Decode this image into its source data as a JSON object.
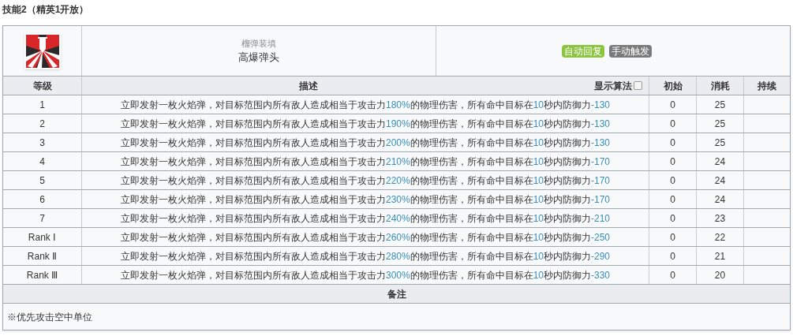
{
  "title": "技能2（精英1开放）",
  "skill": {
    "subtitle": "榴弹装填",
    "name": "高爆弹头",
    "tags": [
      {
        "text": "自动回复",
        "color": "#8cc43f"
      },
      {
        "text": "手动触发",
        "color": "#7a7a7a"
      }
    ]
  },
  "columns": {
    "level": "等级",
    "description": "描述",
    "formula_toggle": {
      "label": "显示算法",
      "checked": false
    },
    "initial": "初始",
    "cost": "消耗",
    "duration": "持续"
  },
  "rows": [
    {
      "level": "1",
      "parts": [
        {
          "kind": "plain",
          "text": "立即发射一枚火焰弹，对目标范围内所有敌人造成相当于攻击力"
        },
        {
          "kind": "value",
          "text": "180%"
        },
        {
          "kind": "plain",
          "text": "的物理伤害，所有命中目标在"
        },
        {
          "kind": "value",
          "text": "10"
        },
        {
          "kind": "plain",
          "text": "秒内防御力"
        },
        {
          "kind": "value",
          "text": "-130"
        }
      ],
      "initial": "0",
      "cost": "25"
    },
    {
      "level": "2",
      "parts": [
        {
          "kind": "plain",
          "text": "立即发射一枚火焰弹，对目标范围内所有敌人造成相当于攻击力"
        },
        {
          "kind": "value",
          "text": "190%"
        },
        {
          "kind": "plain",
          "text": "的物理伤害，所有命中目标在"
        },
        {
          "kind": "value",
          "text": "10"
        },
        {
          "kind": "plain",
          "text": "秒内防御力"
        },
        {
          "kind": "value",
          "text": "-130"
        }
      ],
      "initial": "0",
      "cost": "25"
    },
    {
      "level": "3",
      "parts": [
        {
          "kind": "plain",
          "text": "立即发射一枚火焰弹，对目标范围内所有敌人造成相当于攻击力"
        },
        {
          "kind": "value",
          "text": "200%"
        },
        {
          "kind": "plain",
          "text": "的物理伤害，所有命中目标在"
        },
        {
          "kind": "value",
          "text": "10"
        },
        {
          "kind": "plain",
          "text": "秒内防御力"
        },
        {
          "kind": "value",
          "text": "-130"
        }
      ],
      "initial": "0",
      "cost": "25"
    },
    {
      "level": "4",
      "parts": [
        {
          "kind": "plain",
          "text": "立即发射一枚火焰弹，对目标范围内所有敌人造成相当于攻击力"
        },
        {
          "kind": "value",
          "text": "210%"
        },
        {
          "kind": "plain",
          "text": "的物理伤害，所有命中目标在"
        },
        {
          "kind": "value",
          "text": "10"
        },
        {
          "kind": "plain",
          "text": "秒内防御力"
        },
        {
          "kind": "value",
          "text": "-170"
        }
      ],
      "initial": "0",
      "cost": "24"
    },
    {
      "level": "5",
      "parts": [
        {
          "kind": "plain",
          "text": "立即发射一枚火焰弹，对目标范围内所有敌人造成相当于攻击力"
        },
        {
          "kind": "value",
          "text": "220%"
        },
        {
          "kind": "plain",
          "text": "的物理伤害，所有命中目标在"
        },
        {
          "kind": "value",
          "text": "10"
        },
        {
          "kind": "plain",
          "text": "秒内防御力"
        },
        {
          "kind": "value",
          "text": "-170"
        }
      ],
      "initial": "0",
      "cost": "24"
    },
    {
      "level": "6",
      "parts": [
        {
          "kind": "plain",
          "text": "立即发射一枚火焰弹，对目标范围内所有敌人造成相当于攻击力"
        },
        {
          "kind": "value",
          "text": "230%"
        },
        {
          "kind": "plain",
          "text": "的物理伤害，所有命中目标在"
        },
        {
          "kind": "value",
          "text": "10"
        },
        {
          "kind": "plain",
          "text": "秒内防御力"
        },
        {
          "kind": "value",
          "text": "-170"
        }
      ],
      "initial": "0",
      "cost": "24"
    },
    {
      "level": "7",
      "parts": [
        {
          "kind": "plain",
          "text": "立即发射一枚火焰弹，对目标范围内所有敌人造成相当于攻击力"
        },
        {
          "kind": "value",
          "text": "240%"
        },
        {
          "kind": "plain",
          "text": "的物理伤害，所有命中目标在"
        },
        {
          "kind": "value",
          "text": "10"
        },
        {
          "kind": "plain",
          "text": "秒内防御力"
        },
        {
          "kind": "value",
          "text": "-210"
        }
      ],
      "initial": "0",
      "cost": "23"
    },
    {
      "level": "Rank Ⅰ",
      "parts": [
        {
          "kind": "plain",
          "text": "立即发射一枚火焰弹，对目标范围内所有敌人造成相当于攻击力"
        },
        {
          "kind": "value",
          "text": "260%"
        },
        {
          "kind": "plain",
          "text": "的物理伤害，所有命中目标在"
        },
        {
          "kind": "value",
          "text": "10"
        },
        {
          "kind": "plain",
          "text": "秒内防御力"
        },
        {
          "kind": "value",
          "text": "-250"
        }
      ],
      "initial": "0",
      "cost": "22"
    },
    {
      "level": "Rank Ⅱ",
      "parts": [
        {
          "kind": "plain",
          "text": "立即发射一枚火焰弹，对目标范围内所有敌人造成相当于攻击力"
        },
        {
          "kind": "value",
          "text": "280%"
        },
        {
          "kind": "plain",
          "text": "的物理伤害，所有命中目标在"
        },
        {
          "kind": "value",
          "text": "10"
        },
        {
          "kind": "plain",
          "text": "秒内防御力"
        },
        {
          "kind": "value",
          "text": "-290"
        }
      ],
      "initial": "0",
      "cost": "21"
    },
    {
      "level": "Rank Ⅲ",
      "parts": [
        {
          "kind": "plain",
          "text": "立即发射一枚火焰弹，对目标范围内所有敌人造成相当于攻击力"
        },
        {
          "kind": "value",
          "text": "300%"
        },
        {
          "kind": "plain",
          "text": "的物理伤害，所有命中目标在"
        },
        {
          "kind": "value",
          "text": "10"
        },
        {
          "kind": "plain",
          "text": "秒内防御力"
        },
        {
          "kind": "value",
          "text": "-330"
        }
      ],
      "initial": "0",
      "cost": "20"
    }
  ],
  "notes": {
    "heading": "备注",
    "text": "※优先攻击空中单位"
  }
}
